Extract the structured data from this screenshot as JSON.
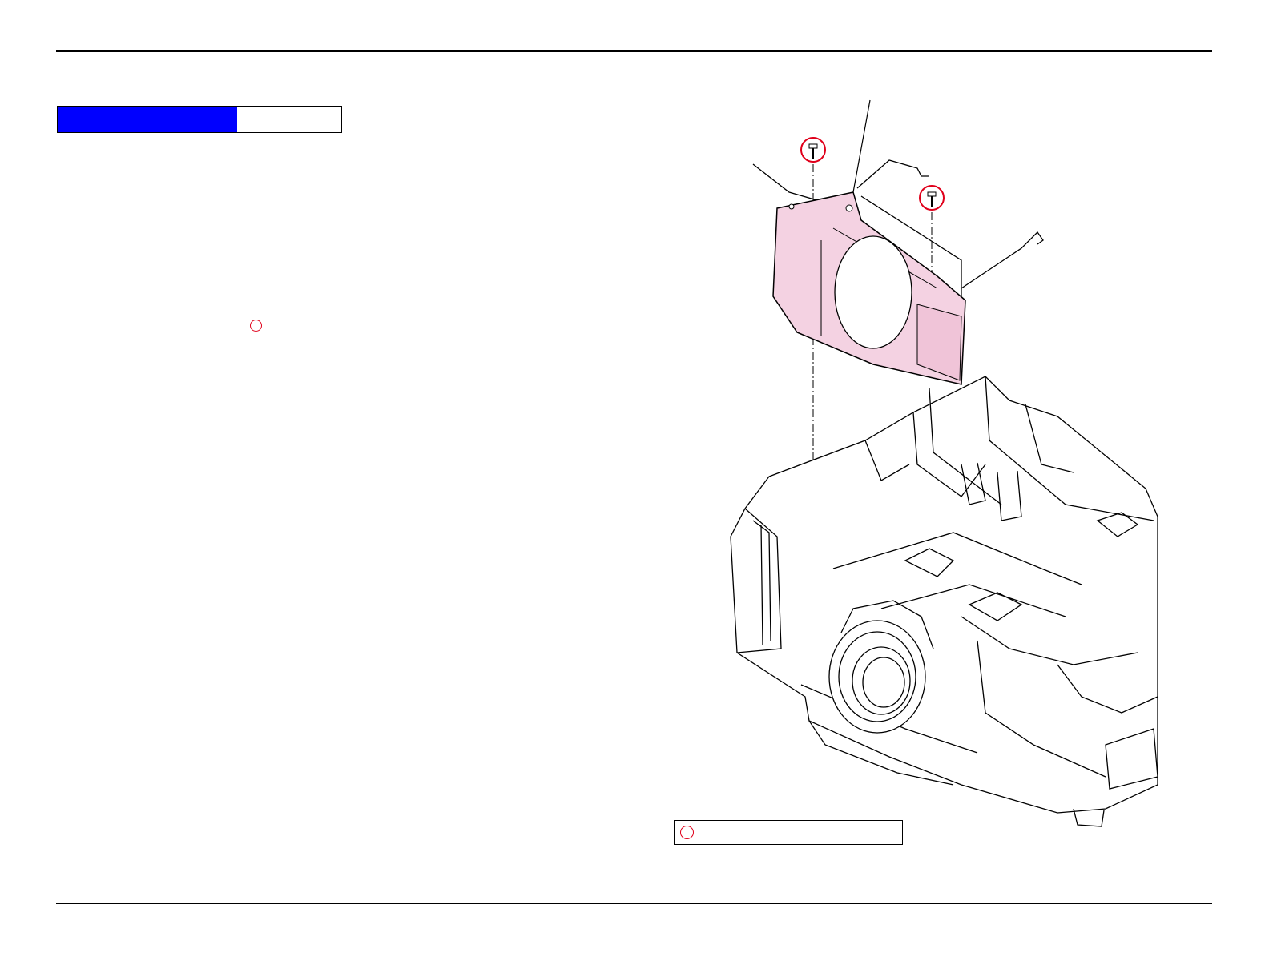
{
  "header": {
    "section_label": "",
    "caption": ""
  },
  "body_text": [],
  "legend": {
    "text": ""
  },
  "colors": {
    "header_fill": "#0000ff",
    "marker": "#e0001b",
    "part_highlight": "#f4d2e2"
  },
  "figure": {
    "highlighted_part": "pink-duct-cover",
    "screw_markers": 2
  }
}
